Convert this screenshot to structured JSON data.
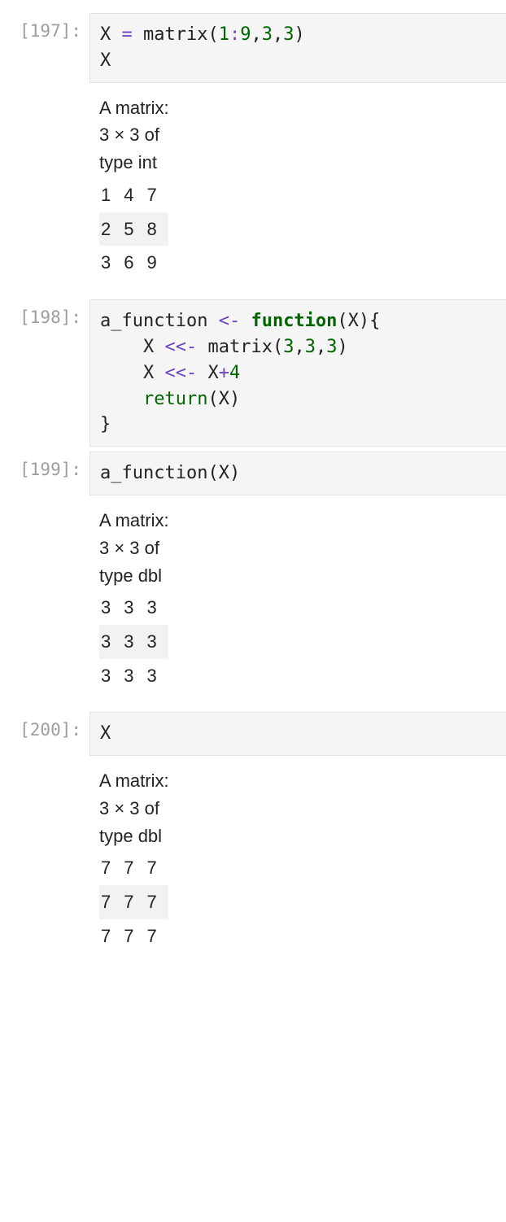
{
  "cells": [
    {
      "prompt": "[197]:",
      "code": [
        [
          {
            "t": "ident",
            "v": "X"
          },
          {
            "t": "sp",
            "v": " "
          },
          {
            "t": "op",
            "v": "="
          },
          {
            "t": "sp",
            "v": " "
          },
          {
            "t": "call",
            "v": "matrix"
          },
          {
            "t": "punct",
            "v": "("
          },
          {
            "t": "num",
            "v": "1"
          },
          {
            "t": "op",
            "v": ":"
          },
          {
            "t": "num",
            "v": "9"
          },
          {
            "t": "punct",
            "v": ","
          },
          {
            "t": "num",
            "v": "3"
          },
          {
            "t": "punct",
            "v": ","
          },
          {
            "t": "num",
            "v": "3"
          },
          {
            "t": "punct",
            "v": ")"
          }
        ],
        [
          {
            "t": "ident",
            "v": "X"
          }
        ]
      ],
      "output": {
        "header_lines": [
          "A matrix:",
          "3 × 3 of",
          "type int"
        ],
        "rows": [
          [
            "1",
            "4",
            "7"
          ],
          [
            "2",
            "5",
            "8"
          ],
          [
            "3",
            "6",
            "9"
          ]
        ]
      }
    },
    {
      "prompt": "[198]:",
      "code": [
        [
          {
            "t": "ident",
            "v": "a_function"
          },
          {
            "t": "sp",
            "v": " "
          },
          {
            "t": "op",
            "v": "<-"
          },
          {
            "t": "sp",
            "v": " "
          },
          {
            "t": "kw",
            "v": "function"
          },
          {
            "t": "punct",
            "v": "("
          },
          {
            "t": "ident",
            "v": "X"
          },
          {
            "t": "punct",
            "v": ")"
          },
          {
            "t": "punct",
            "v": "{"
          }
        ],
        [
          {
            "t": "indent",
            "v": "    "
          },
          {
            "t": "ident",
            "v": "X"
          },
          {
            "t": "sp",
            "v": " "
          },
          {
            "t": "op",
            "v": "<<-"
          },
          {
            "t": "sp",
            "v": " "
          },
          {
            "t": "call",
            "v": "matrix"
          },
          {
            "t": "punct",
            "v": "("
          },
          {
            "t": "num",
            "v": "3"
          },
          {
            "t": "punct",
            "v": ","
          },
          {
            "t": "num",
            "v": "3"
          },
          {
            "t": "punct",
            "v": ","
          },
          {
            "t": "num",
            "v": "3"
          },
          {
            "t": "punct",
            "v": ")"
          }
        ],
        [
          {
            "t": "indent",
            "v": "    "
          },
          {
            "t": "ident",
            "v": "X"
          },
          {
            "t": "sp",
            "v": " "
          },
          {
            "t": "op",
            "v": "<<-"
          },
          {
            "t": "sp",
            "v": " "
          },
          {
            "t": "ident",
            "v": "X"
          },
          {
            "t": "op",
            "v": "+"
          },
          {
            "t": "num",
            "v": "4"
          }
        ],
        [
          {
            "t": "indent",
            "v": "    "
          },
          {
            "t": "return",
            "v": "return"
          },
          {
            "t": "punct",
            "v": "("
          },
          {
            "t": "ident",
            "v": "X"
          },
          {
            "t": "punct",
            "v": ")"
          }
        ],
        [
          {
            "t": "punct",
            "v": "}"
          }
        ]
      ],
      "output": null
    },
    {
      "prompt": "[199]:",
      "code": [
        [
          {
            "t": "ident",
            "v": "a_function"
          },
          {
            "t": "punct",
            "v": "("
          },
          {
            "t": "ident",
            "v": "X"
          },
          {
            "t": "punct",
            "v": ")"
          }
        ]
      ],
      "output": {
        "header_lines": [
          "A matrix:",
          "3 × 3 of",
          "type dbl"
        ],
        "rows": [
          [
            "3",
            "3",
            "3"
          ],
          [
            "3",
            "3",
            "3"
          ],
          [
            "3",
            "3",
            "3"
          ]
        ]
      }
    },
    {
      "prompt": "[200]:",
      "code": [
        [
          {
            "t": "ident",
            "v": "X"
          }
        ]
      ],
      "output": {
        "header_lines": [
          "A matrix:",
          "3 × 3 of",
          "type dbl"
        ],
        "rows": [
          [
            "7",
            "7",
            "7"
          ],
          [
            "7",
            "7",
            "7"
          ],
          [
            "7",
            "7",
            "7"
          ]
        ]
      }
    }
  ]
}
